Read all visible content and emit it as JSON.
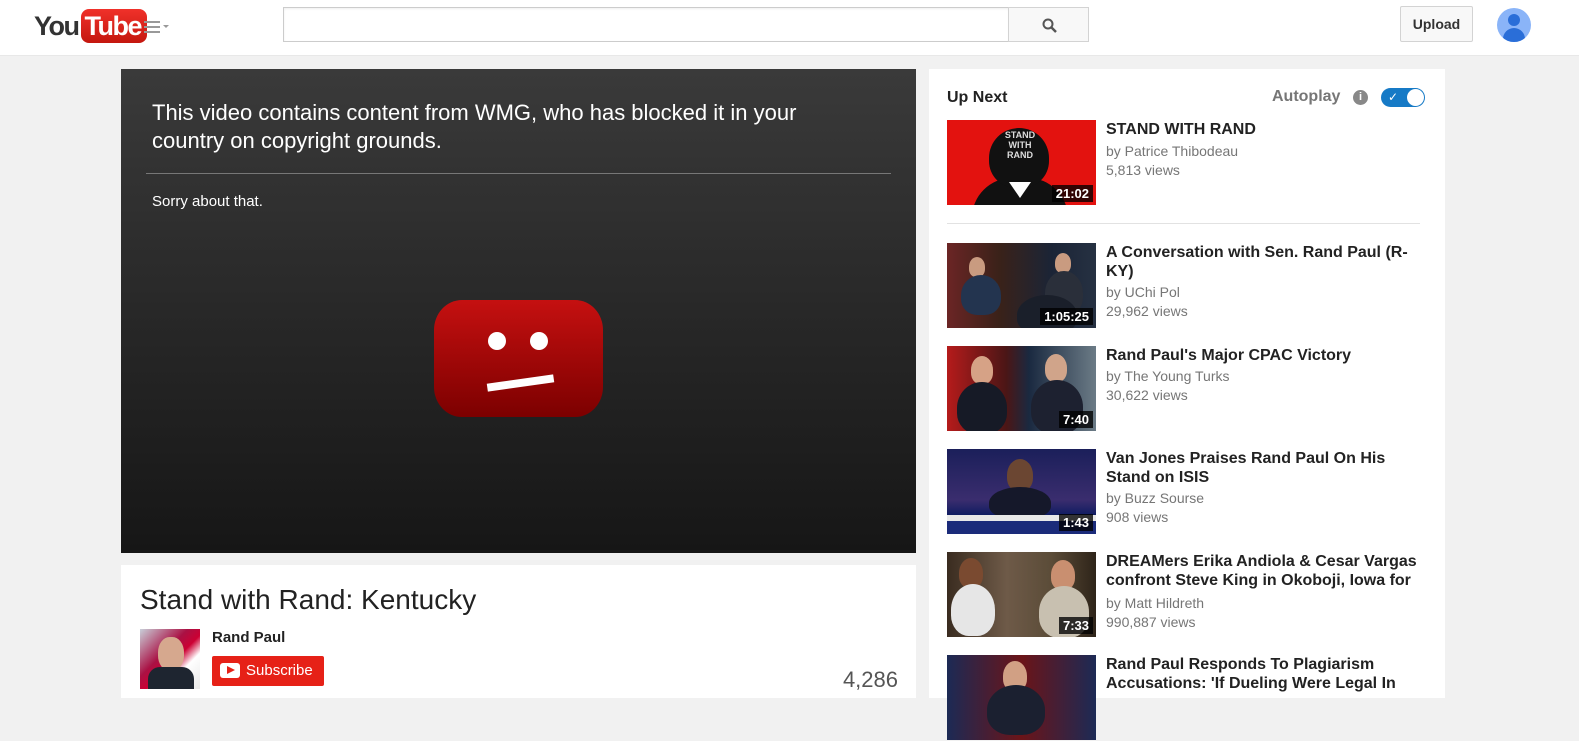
{
  "header": {
    "logo_you": "You",
    "logo_tube": "Tube",
    "search_placeholder": "",
    "upload_label": "Upload"
  },
  "player": {
    "message": "This video contains content from WMG, who has blocked it in your country on copyright grounds.",
    "sorry": "Sorry about that."
  },
  "video": {
    "title": "Stand with Rand: Kentucky",
    "channel": "Rand Paul",
    "subscribe_label": "Subscribe",
    "view_count": "4,286"
  },
  "sidebar": {
    "up_next_label": "Up Next",
    "autoplay_label": "Autoplay",
    "autoplay_on": true,
    "items": [
      {
        "title": "STAND WITH RAND",
        "channel": "by Patrice Thibodeau",
        "views": "5,813 views",
        "duration": "21:02",
        "thumb_text": "STAND WITH RAND"
      },
      {
        "title": "A Conversation with Sen. Rand Paul (R-KY)",
        "channel": "by UChi Pol",
        "views": "29,962 views",
        "duration": "1:05:25"
      },
      {
        "title": "Rand Paul's Major CPAC Victory",
        "channel": "by The Young Turks",
        "views": "30,622 views",
        "duration": "7:40"
      },
      {
        "title": "Van Jones Praises Rand Paul On His Stand on ISIS",
        "channel": "by Buzz Sourse",
        "views": "908 views",
        "duration": "1:43"
      },
      {
        "title": "DREAMers Erika Andiola & Cesar Vargas confront Steve King in Okoboji, Iowa for",
        "channel": "by Matt Hildreth",
        "views": "990,887 views",
        "duration": "7:33"
      },
      {
        "title": "Rand Paul Responds To Plagiarism Accusations: 'If Dueling Were Legal In",
        "channel": "",
        "views": "",
        "duration": ""
      }
    ]
  },
  "colors": {
    "brand_red": "#e62117",
    "toggle_blue": "#167ac6"
  }
}
